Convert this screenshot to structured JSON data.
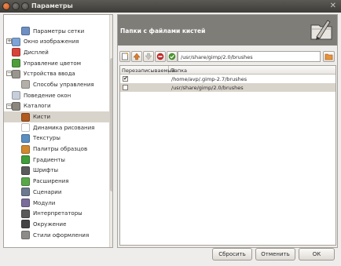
{
  "window": {
    "title": "Параметры",
    "close_glyph": "✕"
  },
  "tree": {
    "items": [
      {
        "label": "",
        "indent": 0,
        "expander": "",
        "icon": "",
        "color": ""
      },
      {
        "label": "Параметры сетки",
        "indent": 1,
        "expander": "",
        "icon": "grid-icon",
        "color": "#6d8fc4"
      },
      {
        "label": "Окно изображения",
        "indent": 0,
        "expander": "+",
        "icon": "image-window-icon",
        "color": "#7ea3d6"
      },
      {
        "label": "Дисплей",
        "indent": 0,
        "expander": "",
        "icon": "display-icon",
        "color": "#d8433a"
      },
      {
        "label": "Управление цветом",
        "indent": 0,
        "expander": "",
        "icon": "color-management-icon",
        "color": "#4f9e3c"
      },
      {
        "label": "Устройства ввода",
        "indent": 0,
        "expander": "−",
        "icon": "input-devices-icon",
        "color": "#9a968f"
      },
      {
        "label": "Способы управления",
        "indent": 1,
        "expander": "",
        "icon": "controllers-icon",
        "color": "#b4b0a9"
      },
      {
        "label": "Поведение окон",
        "indent": 0,
        "expander": "",
        "icon": "window-management-icon",
        "color": "#c7cfdb"
      },
      {
        "label": "Каталоги",
        "indent": 0,
        "expander": "−",
        "icon": "folders-icon",
        "color": "#8c877e"
      },
      {
        "label": "Кисти",
        "indent": 1,
        "expander": "",
        "icon": "brushes-icon",
        "color": "#b25a20"
      },
      {
        "label": "Динамика рисования",
        "indent": 1,
        "expander": "",
        "icon": "dynamics-icon",
        "color": "#ffffff"
      },
      {
        "label": "Текстуры",
        "indent": 1,
        "expander": "",
        "icon": "patterns-icon",
        "color": "#5b8fc2"
      },
      {
        "label": "Палитры образцов",
        "indent": 1,
        "expander": "",
        "icon": "palettes-icon",
        "color": "#d1892f"
      },
      {
        "label": "Градиенты",
        "indent": 1,
        "expander": "",
        "icon": "gradients-icon",
        "color": "#3f9d3a"
      },
      {
        "label": "Шрифты",
        "indent": 1,
        "expander": "",
        "icon": "fonts-icon",
        "color": "#5a5a5a"
      },
      {
        "label": "Расширения",
        "indent": 1,
        "expander": "",
        "icon": "plugins-icon",
        "color": "#58a84a"
      },
      {
        "label": "Сценарии",
        "indent": 1,
        "expander": "",
        "icon": "scripts-icon",
        "color": "#6b7a8e"
      },
      {
        "label": "Модули",
        "indent": 1,
        "expander": "",
        "icon": "modules-icon",
        "color": "#7a6c9b"
      },
      {
        "label": "Интерпретаторы",
        "indent": 1,
        "expander": "",
        "icon": "interpreters-icon",
        "color": "#5a5a5a"
      },
      {
        "label": "Окружение",
        "indent": 1,
        "expander": "",
        "icon": "environment-icon",
        "color": "#444444"
      },
      {
        "label": "Стили оформления",
        "indent": 1,
        "expander": "",
        "icon": "themes-icon",
        "color": "#8d8c88"
      },
      {
        "label": "",
        "indent": 1,
        "expander": "",
        "icon": "",
        "color": ""
      }
    ]
  },
  "panel": {
    "title": "Папки с файлами кистей",
    "path_value": "/usr/share/gimp/2.0/brushes",
    "toolbar_icons": [
      "new-folder-icon",
      "move-up-icon",
      "move-down-icon",
      "delete-icon",
      "check-icon"
    ],
    "columns": [
      "Перезаписываемый",
      "Папка"
    ],
    "rows": [
      {
        "writable": "✔",
        "folder": "/home/avp/.gimp-2.7/brushes",
        "selected": false
      },
      {
        "writable": "",
        "folder": "/usr/share/gimp/2.0/brushes",
        "selected": true
      }
    ]
  },
  "buttons": {
    "reset": "Сбросить",
    "cancel": "Отменить",
    "ok": "ОК"
  },
  "colors": {
    "header": "#7f7d78",
    "selection": "#d9d4cb",
    "titlebar": "#3d3c38",
    "close_button": "#e56f2f"
  }
}
